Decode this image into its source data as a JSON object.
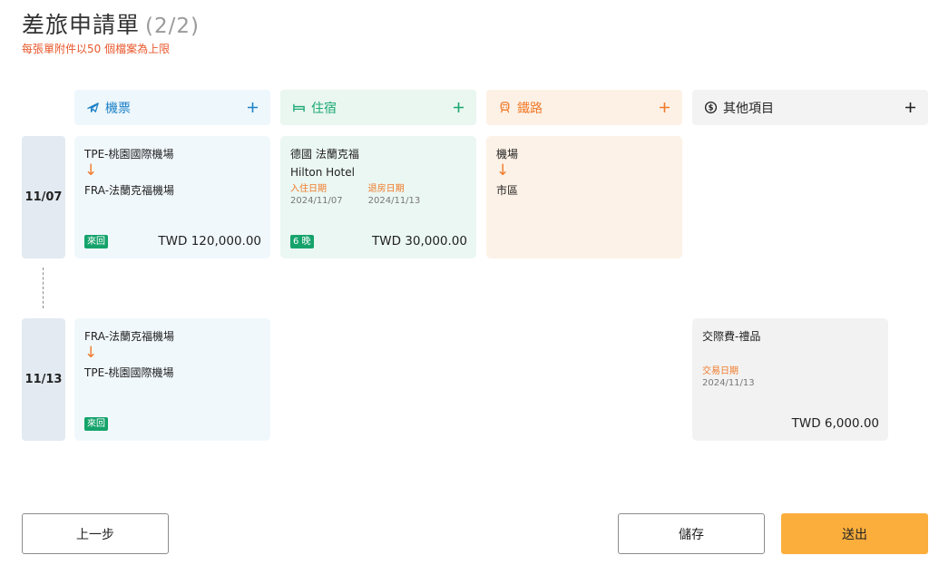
{
  "header": {
    "title": "差旅申請單",
    "step": "(2/2)",
    "note": "每張單附件以50 個檔案為上限"
  },
  "columns": {
    "flight": {
      "label": "機票",
      "icon": "plane-icon"
    },
    "hotel": {
      "label": "住宿",
      "icon": "bed-icon"
    },
    "rail": {
      "label": "鐵路",
      "icon": "train-icon"
    },
    "other": {
      "label": "其他項目",
      "icon": "dollar-icon"
    }
  },
  "colors": {
    "flight": "#1d82c6",
    "hotel": "#18a872",
    "rail": "#f07a2a",
    "submit": "#fbae3c"
  },
  "days": [
    {
      "date": "11/07",
      "flight": {
        "from": "TPE-桃園國際機場",
        "to": "FRA-法蘭克福機場",
        "badge": "來回",
        "amount": "TWD 120,000.00"
      },
      "hotel": {
        "location": "德國 法蘭克福",
        "name": "Hilton Hotel",
        "checkin_label": "入住日期",
        "checkin": "2024/11/07",
        "checkout_label": "退房日期",
        "checkout": "2024/11/13",
        "badge": "6 晚",
        "amount": "TWD 30,000.00"
      },
      "rail": {
        "from": "機場",
        "to": "市區"
      }
    },
    {
      "date": "11/13",
      "flight": {
        "from": "FRA-法蘭克福機場",
        "to": "TPE-桃園國際機場",
        "badge": "來回"
      },
      "other": {
        "name": "交際費-禮品",
        "date_label": "交易日期",
        "date": "2024/11/13",
        "amount": "TWD 6,000.00"
      }
    }
  ],
  "arrow": "↓",
  "buttons": {
    "prev": "上一步",
    "save": "儲存",
    "submit": "送出"
  }
}
